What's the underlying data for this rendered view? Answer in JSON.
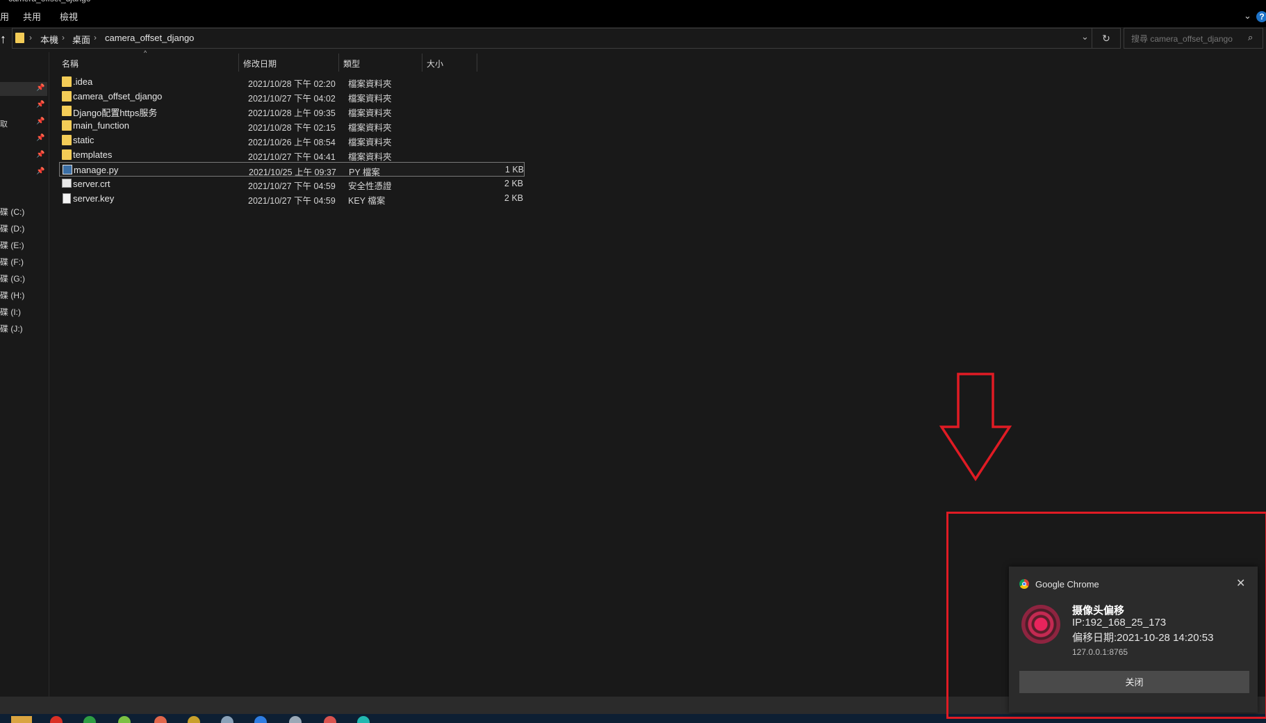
{
  "window": {
    "title": "camera_offset_django"
  },
  "ribbon": {
    "tabs": [
      "用",
      "共用",
      "檢視"
    ]
  },
  "address": {
    "breadcrumbs": [
      "本機",
      "桌面",
      "camera_offset_django"
    ],
    "refresh_glyph": "↻",
    "dropdown_glyph": "⌄"
  },
  "search": {
    "placeholder": "搜尋 camera_offset_django",
    "icon": "search-icon"
  },
  "nav": {
    "top_label": "取",
    "drives": [
      "碟 (C:)",
      "碟 (D:)",
      "碟 (E:)",
      "碟 (F:)",
      "碟 (G:)",
      "碟 (H:)",
      "碟 (I:)",
      "碟 (J:)"
    ]
  },
  "columns": {
    "name": "名稱",
    "date": "修改日期",
    "type": "類型",
    "size": "大小"
  },
  "files": [
    {
      "name": ".idea",
      "date": "2021/10/28 下午 02:20",
      "type": "檔案資料夾",
      "size": "",
      "icon": "folder-icon"
    },
    {
      "name": "camera_offset_django",
      "date": "2021/10/27 下午 04:02",
      "type": "檔案資料夾",
      "size": "",
      "icon": "folder-icon"
    },
    {
      "name": "Django配置https服务",
      "date": "2021/10/28 上午 09:35",
      "type": "檔案資料夾",
      "size": "",
      "icon": "folder-icon"
    },
    {
      "name": "main_function",
      "date": "2021/10/28 下午 02:15",
      "type": "檔案資料夾",
      "size": "",
      "icon": "folder-icon"
    },
    {
      "name": "static",
      "date": "2021/10/26 上午 08:54",
      "type": "檔案資料夾",
      "size": "",
      "icon": "folder-icon"
    },
    {
      "name": "templates",
      "date": "2021/10/27 下午 04:41",
      "type": "檔案資料夾",
      "size": "",
      "icon": "folder-icon"
    },
    {
      "name": "manage.py",
      "date": "2021/10/25 上午 09:37",
      "type": "PY 檔案",
      "size": "1 KB",
      "icon": "python-file-icon",
      "selected": true
    },
    {
      "name": "server.crt",
      "date": "2021/10/27 下午 04:59",
      "type": "安全性憑證",
      "size": "2 KB",
      "icon": "certificate-file-icon"
    },
    {
      "name": "server.key",
      "date": "2021/10/27 下午 04:59",
      "type": "KEY 檔案",
      "size": "2 KB",
      "icon": "key-file-icon"
    }
  ],
  "notification": {
    "app": "Google Chrome",
    "title": "摄像头偏移",
    "line1": "IP:192_168_25_173",
    "line2": "偏移日期:2021-10-28 14:20:53",
    "origin": "127.0.0.1:8765",
    "action": "关闭",
    "close_glyph": "✕"
  },
  "colors": {
    "annotation": "#e01b24",
    "folder": "#f3cc57",
    "background": "#191919"
  }
}
